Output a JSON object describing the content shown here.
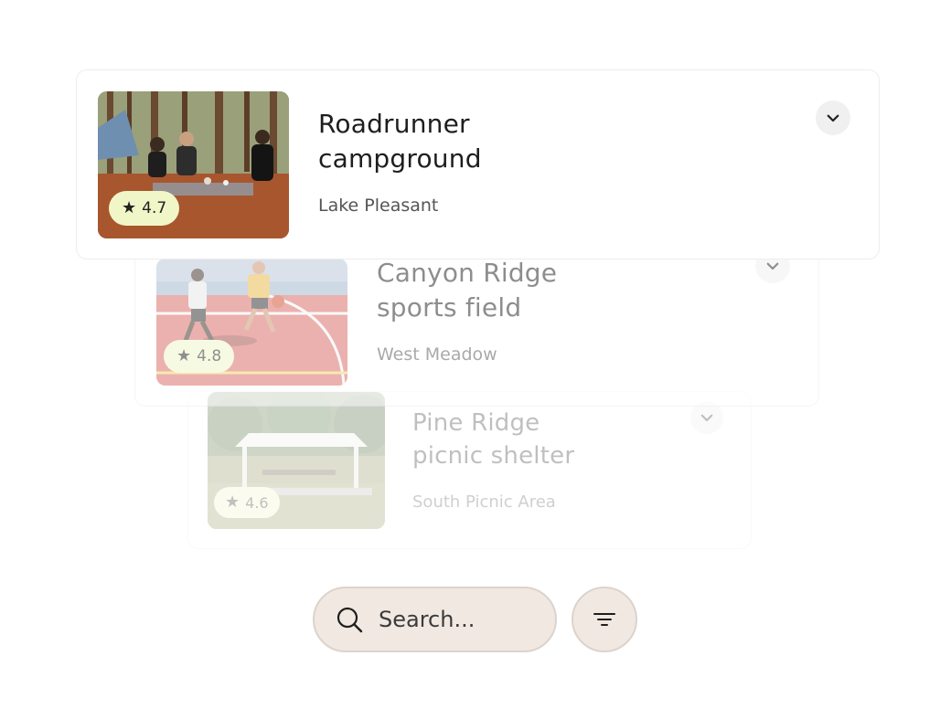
{
  "results": [
    {
      "title_line1": "Roadrunner",
      "title_line2": "campground",
      "location": "Lake Pleasant",
      "rating": "4.7",
      "image": "campers-in-pine-forest"
    },
    {
      "title_line1": "Canyon Ridge",
      "title_line2": "sports field",
      "location": "West Meadow",
      "rating": "4.8",
      "image": "basketball-players-on-court"
    },
    {
      "title_line1": "Pine Ridge",
      "title_line2": "picnic shelter",
      "location": "South Picnic Area",
      "rating": "4.6",
      "image": "park-picnic-shelter"
    }
  ],
  "search": {
    "placeholder": "Search..."
  },
  "icons": {
    "search": "search-icon",
    "filter": "filter-icon",
    "expand": "chevron-down-icon",
    "rating": "star-icon"
  },
  "colors": {
    "rating_badge": "#f1f6c8",
    "search_bg": "#f1e8e1",
    "search_border": "#dcd3cc"
  }
}
